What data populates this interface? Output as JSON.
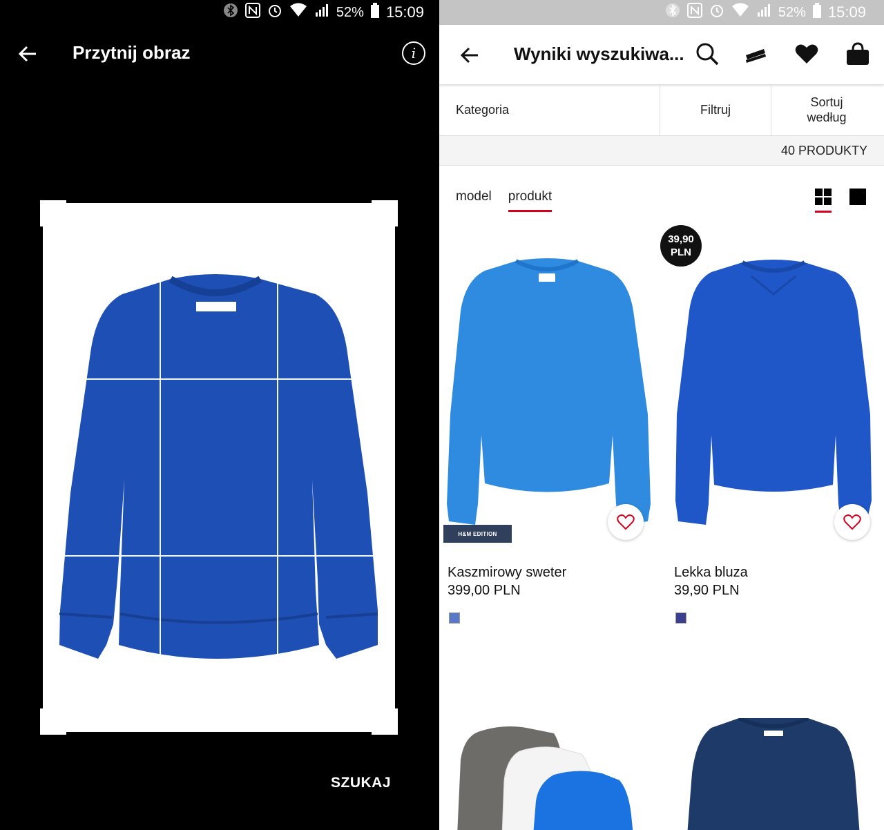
{
  "status_bar": {
    "battery": "52%",
    "time": "15:09"
  },
  "crop_screen": {
    "title": "Przytnij obraz",
    "search_label": "SZUKAJ"
  },
  "results_screen": {
    "title": "Wyniki wyszukiwa...",
    "filters": {
      "category": "Kategoria",
      "filter": "Filtruj",
      "sort_line1": "Sortuj",
      "sort_line2": "według"
    },
    "count": "40 PRODUKTY",
    "tabs": [
      "model",
      "produkt"
    ],
    "active_tab": "produkt",
    "products": [
      {
        "name": "Kaszmirowy sweter",
        "price": "399,00 PLN",
        "label": "H&M EDITION",
        "swatch": "#5a78c8",
        "color": "#2f8be0"
      },
      {
        "name": "Lekka bluza",
        "price": "39,90 PLN",
        "badge_line1": "39,90",
        "badge_line2": "PLN",
        "swatch": "#3a3f8f",
        "color": "#1f57c9"
      }
    ],
    "accent_color": "#d6001c"
  }
}
